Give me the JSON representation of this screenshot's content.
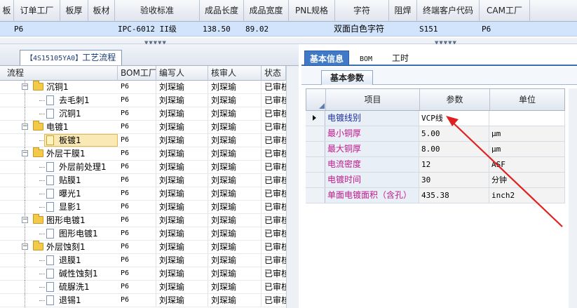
{
  "top_grid": {
    "headers": [
      "板",
      "订单工厂",
      "板厚",
      "板材",
      "验收标准",
      "成品长度",
      "成品宽度",
      "PNL规格",
      "字符",
      "阻焊",
      "终端客户代码",
      "CAM工厂"
    ],
    "row": [
      "P6",
      "",
      "",
      "",
      "IPC-6012 II级",
      "138.50",
      "89.02",
      "",
      "双面白色字符",
      "",
      "S151",
      "P6"
    ]
  },
  "left_panel": {
    "tab_code": "【4S15105YA0】",
    "tab_title": "工艺流程",
    "columns": [
      "流程",
      "BOM工厂",
      "编写人",
      "核审人",
      "状态"
    ],
    "rows": [
      {
        "name": "沉铜1",
        "level": 0,
        "folder": true,
        "factory": "P6",
        "writer": "刘琛瑜",
        "reviewer": "刘琛瑜",
        "status": "已审核"
      },
      {
        "name": "去毛刺1",
        "level": 1,
        "folder": false,
        "factory": "P6",
        "writer": "刘琛瑜",
        "reviewer": "刘琛瑜",
        "status": "已审核"
      },
      {
        "name": "沉铜1",
        "level": 1,
        "folder": false,
        "factory": "P6",
        "writer": "刘琛瑜",
        "reviewer": "刘琛瑜",
        "status": "已审核"
      },
      {
        "name": "电镀1",
        "level": 0,
        "folder": true,
        "factory": "P6",
        "writer": "刘琛瑜",
        "reviewer": "刘琛瑜",
        "status": "已审核"
      },
      {
        "name": "板镀1",
        "level": 1,
        "folder": false,
        "selected": true,
        "factory": "P6",
        "writer": "刘琛瑜",
        "reviewer": "刘琛瑜",
        "status": "已审核"
      },
      {
        "name": "外层干膜1",
        "level": 0,
        "folder": true,
        "factory": "P6",
        "writer": "刘琛瑜",
        "reviewer": "刘琛瑜",
        "status": "已审核"
      },
      {
        "name": "外层前处理1",
        "level": 1,
        "folder": false,
        "factory": "P6",
        "writer": "刘琛瑜",
        "reviewer": "刘琛瑜",
        "status": "已审核"
      },
      {
        "name": "贴膜1",
        "level": 1,
        "folder": false,
        "factory": "P6",
        "writer": "刘琛瑜",
        "reviewer": "刘琛瑜",
        "status": "已审核"
      },
      {
        "name": "曝光1",
        "level": 1,
        "folder": false,
        "factory": "P6",
        "writer": "刘琛瑜",
        "reviewer": "刘琛瑜",
        "status": "已审核"
      },
      {
        "name": "显影1",
        "level": 1,
        "folder": false,
        "factory": "P6",
        "writer": "刘琛瑜",
        "reviewer": "刘琛瑜",
        "status": "已审核"
      },
      {
        "name": "图形电镀1",
        "level": 0,
        "folder": true,
        "factory": "P6",
        "writer": "刘琛瑜",
        "reviewer": "刘琛瑜",
        "status": "已审核"
      },
      {
        "name": "图形电镀1",
        "level": 1,
        "folder": false,
        "factory": "P6",
        "writer": "刘琛瑜",
        "reviewer": "刘琛瑜",
        "status": "已审核"
      },
      {
        "name": "外层蚀刻1",
        "level": 0,
        "folder": true,
        "factory": "P6",
        "writer": "刘琛瑜",
        "reviewer": "刘琛瑜",
        "status": "已审核"
      },
      {
        "name": "退膜1",
        "level": 1,
        "folder": false,
        "factory": "P6",
        "writer": "刘琛瑜",
        "reviewer": "刘琛瑜",
        "status": "已审核"
      },
      {
        "name": "碱性蚀刻1",
        "level": 1,
        "folder": false,
        "factory": "P6",
        "writer": "刘琛瑜",
        "reviewer": "刘琛瑜",
        "status": "已审核"
      },
      {
        "name": "硫脲洗1",
        "level": 1,
        "folder": false,
        "factory": "P6",
        "writer": "刘琛瑜",
        "reviewer": "刘琛瑜",
        "status": "已审核"
      },
      {
        "name": "退锡1",
        "level": 1,
        "folder": false,
        "factory": "P6",
        "writer": "刘琛瑜",
        "reviewer": "刘琛瑜",
        "status": "已审核"
      }
    ]
  },
  "right_panel": {
    "tabs": [
      "基本信息",
      "BOM",
      "工时"
    ],
    "active_tab": "基本信息",
    "subtab": "基本参数",
    "columns": [
      "项目",
      "参数",
      "单位"
    ],
    "params": [
      {
        "name": "电镀线别",
        "value": "VCP线",
        "unit": ""
      },
      {
        "name": "最小铜厚",
        "value": "5.00",
        "unit": "μm"
      },
      {
        "name": "最大铜厚",
        "value": "8.00",
        "unit": "μm"
      },
      {
        "name": "电流密度",
        "value": "12",
        "unit": "ASF"
      },
      {
        "name": "电镀时间",
        "value": "30",
        "unit": "分钟"
      },
      {
        "name": "单面电镀面积（含孔）",
        "value": "435.38",
        "unit": "inch2"
      }
    ]
  },
  "colors": {
    "selected_row_bg": "#d2e4fb",
    "active_tab_bg": "#3f79c8",
    "param_label_color": "#c0198b",
    "annotation_arrow": "#e02020"
  }
}
